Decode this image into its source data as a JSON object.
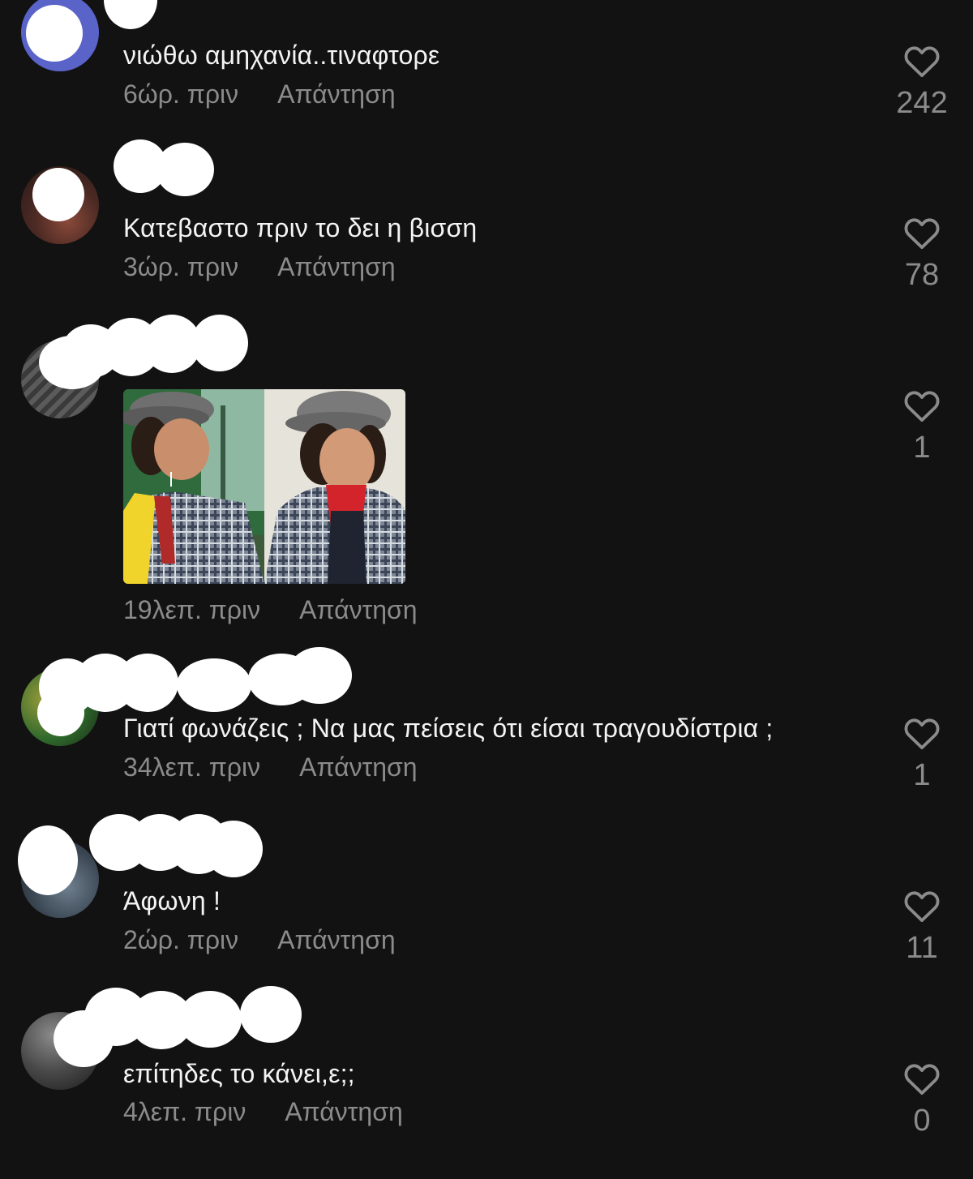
{
  "comments": [
    {
      "text": "νιώθω αμηχανία..τιναφτορε",
      "time": "6ώρ. πριν",
      "reply": "Απάντηση",
      "likes": "242"
    },
    {
      "text": "Κατεβαστο πριν το δει η βισση",
      "time": "3ώρ. πριν",
      "reply": "Απάντηση",
      "likes": "78"
    },
    {
      "text": "",
      "time": "19λεπ. πριν",
      "reply": "Απάντηση",
      "likes": "1"
    },
    {
      "text": "Γιατί φωνάζεις ; Να μας πείσεις ότι είσαι τραγουδίστρια ;",
      "time": "34λεπ. πριν",
      "reply": "Απάντηση",
      "likes": "1"
    },
    {
      "text": "Άφωνη !",
      "time": "2ώρ. πριν",
      "reply": "Απάντηση",
      "likes": "11"
    },
    {
      "text": "επίτηδες το κάνει,ε;;",
      "time": "4λεπ. πριν",
      "reply": "Απάντηση",
      "likes": "0"
    }
  ],
  "icons": {
    "like": "heart-outline-icon",
    "reply": "reply-link"
  },
  "colors": {
    "background": "#121212",
    "text": "#f4f4f4",
    "muted": "#8b8b8b",
    "avatar_ring": "#5a63c8",
    "redaction": "#ffffff"
  }
}
